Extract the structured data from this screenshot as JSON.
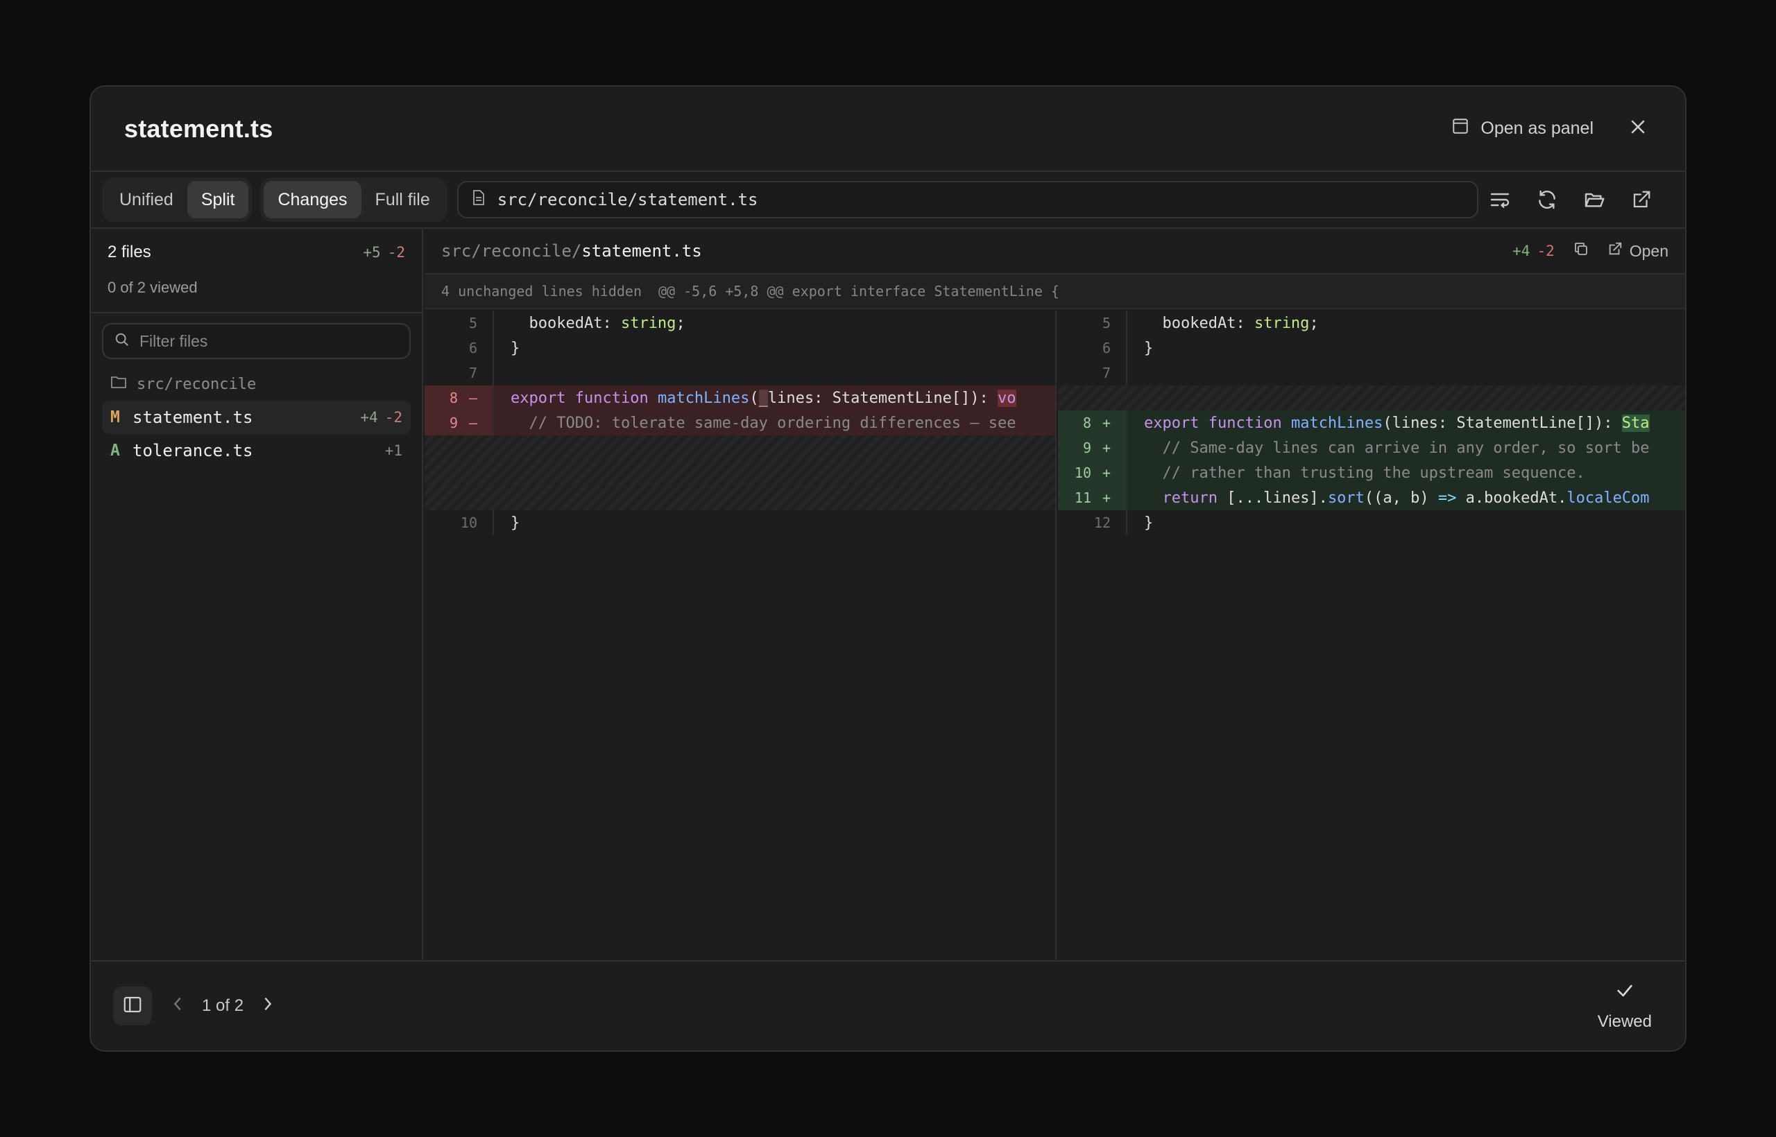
{
  "modal": {
    "title": "statement.ts",
    "open_as_panel": "Open as panel"
  },
  "toolbar": {
    "view_modes": [
      "Unified",
      "Split"
    ],
    "active_view_mode": "Split",
    "scope_modes": [
      "Changes",
      "Full file"
    ],
    "active_scope_mode": "Changes",
    "path": "src/reconcile/statement.ts",
    "icons": [
      "wrap-lines-icon",
      "refresh-icon",
      "folder-open-icon",
      "external-link-icon"
    ]
  },
  "sidebar": {
    "files_count": "2 files",
    "total_add": "+5",
    "total_del": "-2",
    "viewed": "0 of 2 viewed",
    "filter_placeholder": "Filter files",
    "folder": "src/reconcile",
    "files": [
      {
        "status": "M",
        "name": "statement.ts",
        "add": "+4",
        "del": "-2",
        "selected": true
      },
      {
        "status": "A",
        "name": "tolerance.ts",
        "add": "+1",
        "del": "",
        "selected": false
      }
    ]
  },
  "diff": {
    "dir": "src/reconcile/",
    "base": "statement.ts",
    "add": "+4",
    "del": "-2",
    "open_label": "Open",
    "hunk_hidden": "4 unchanged lines hidden",
    "hunk_header": "@@ -5,6 +5,8 @@ export interface StatementLine {",
    "left": [
      {
        "n": "5",
        "sign": "",
        "type": "ctx",
        "text": "  bookedAt: string;"
      },
      {
        "n": "6",
        "sign": "",
        "type": "ctx",
        "text": "}"
      },
      {
        "n": "7",
        "sign": "",
        "type": "ctx",
        "text": ""
      },
      {
        "n": "8",
        "sign": "–",
        "type": "del",
        "text": "export function matchLines(_lines: StatementLine[]): vo"
      },
      {
        "n": "9",
        "sign": "–",
        "type": "del",
        "text": "  // TODO: tolerate same-day ordering differences — see"
      },
      {
        "n": "",
        "sign": "",
        "type": "filler",
        "text": ""
      },
      {
        "n": "",
        "sign": "",
        "type": "filler",
        "text": ""
      },
      {
        "n": "",
        "sign": "",
        "type": "filler",
        "text": ""
      },
      {
        "n": "10",
        "sign": "",
        "type": "ctx",
        "text": "}"
      }
    ],
    "right": [
      {
        "n": "5",
        "sign": "",
        "type": "ctx",
        "text": "  bookedAt: string;"
      },
      {
        "n": "6",
        "sign": "",
        "type": "ctx",
        "text": "}"
      },
      {
        "n": "7",
        "sign": "",
        "type": "ctx",
        "text": ""
      },
      {
        "n": "",
        "sign": "",
        "type": "filler",
        "text": ""
      },
      {
        "n": "8",
        "sign": "+",
        "type": "add",
        "text": "export function matchLines(lines: StatementLine[]): Sta"
      },
      {
        "n": "9",
        "sign": "+",
        "type": "add",
        "text": "  // Same-day lines can arrive in any order, so sort be"
      },
      {
        "n": "10",
        "sign": "+",
        "type": "add",
        "text": "  // rather than trusting the upstream sequence."
      },
      {
        "n": "11",
        "sign": "+",
        "type": "add",
        "text": "  return [...lines].sort((a, b) => a.bookedAt.localeCom"
      },
      {
        "n": "12",
        "sign": "",
        "type": "ctx",
        "text": "}"
      }
    ]
  },
  "footer": {
    "pager": "1 of 2",
    "viewed_label": "Viewed"
  }
}
